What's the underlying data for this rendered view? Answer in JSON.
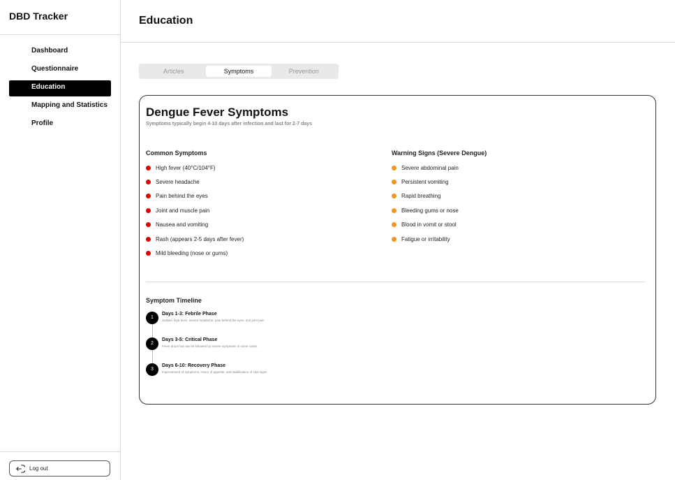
{
  "app": {
    "brand": "DBD Tracker"
  },
  "sidebar": {
    "items": [
      {
        "label": "Dashboard",
        "active": false
      },
      {
        "label": "Questionnaire",
        "active": false
      },
      {
        "label": "Education",
        "active": true
      },
      {
        "label": "Mapping and Statistics",
        "active": false
      },
      {
        "label": "Profile",
        "active": false
      }
    ],
    "logout_label": "Log out",
    "logout_icon": "logout-icon"
  },
  "header": {
    "title": "Education"
  },
  "tabs": [
    {
      "label": "Articles",
      "active": false
    },
    {
      "label": "Symptoms",
      "active": true
    },
    {
      "label": "Prevention",
      "active": false
    }
  ],
  "card": {
    "title": "Dengue Fever Symptoms",
    "subtitle": "Symptoms typically begin 4-10 days after infection and last for 2-7 days",
    "common": {
      "heading": "Common Symptoms",
      "bullet_color": "#e00000",
      "items": [
        "High fever (40°C/104°F)",
        "Severe headache",
        "Pain behind the eyes",
        "Joint and muscle pain",
        "Nausea and vomiting",
        "Rash (appears 2-5 days after fever)",
        "Mild bleeding (nose or gums)"
      ]
    },
    "warning": {
      "heading": "Warning Signs (Severe Dengue)",
      "bullet_color": "#f7931e",
      "items": [
        "Severe abdominal pain",
        "Persistent vomiting",
        "Rapid breathing",
        "Bleeding gums or nose",
        "Blood in vomit or stool",
        "Fatigue or irritability"
      ]
    },
    "timeline": {
      "heading": "Symptom Timeline",
      "items": [
        {
          "num": "1",
          "title": "Days 1-3: Febrile Phase",
          "desc": "Sudden high fever, severe headache, pain behind the eyes, and joint pain"
        },
        {
          "num": "2",
          "title": "Days 3-5: Critical Phase",
          "desc": "Fever drops but can be followed by severe symptoms in some cases"
        },
        {
          "num": "3",
          "title": "Days 6-10: Recovery Phase",
          "desc": "Improvement of symptoms, return of appetite, and stabilization of vital signs"
        }
      ]
    }
  }
}
